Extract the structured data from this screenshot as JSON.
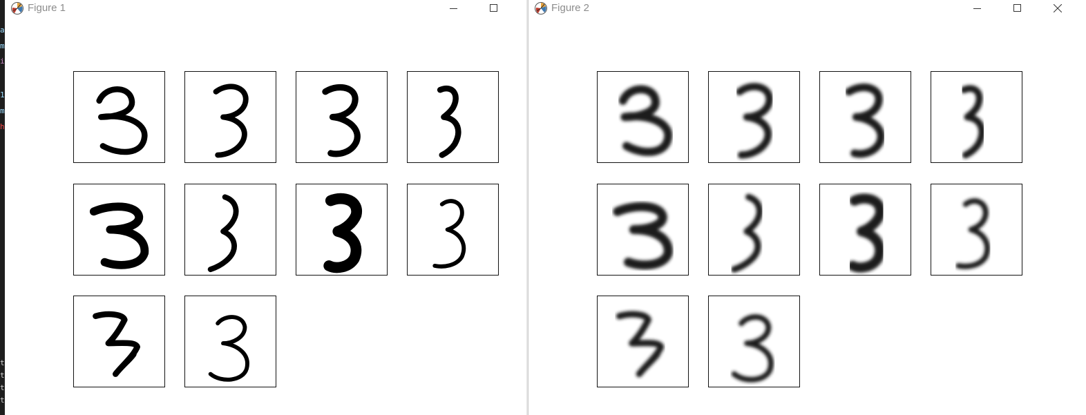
{
  "windows": [
    {
      "title": "Figure 1",
      "controls": [
        "minimize-icon",
        "maximize-icon"
      ],
      "grid": {
        "cols": 4,
        "count": 10
      },
      "style": "crisp"
    },
    {
      "title": "Figure 2",
      "controls": [
        "minimize-icon",
        "maximize-icon",
        "close-icon"
      ],
      "grid": {
        "cols": 4,
        "count": 10
      },
      "style": "blurred"
    }
  ],
  "digits_shown": "3",
  "background_editor_glyphs": [
    {
      "ch": "a",
      "color": "#9cdcfe"
    },
    {
      "ch": "m",
      "color": "#9cdcfe"
    },
    {
      "ch": "i",
      "color": "#c586c0"
    },
    {
      "ch": "1",
      "color": "#9cdcfe"
    },
    {
      "ch": "m",
      "color": "#9cdcfe"
    },
    {
      "ch": "h",
      "color": "#f44747"
    },
    {
      "ch": "t",
      "color": "#d4d4d4"
    },
    {
      "ch": "t",
      "color": "#d4d4d4"
    },
    {
      "ch": "t",
      "color": "#d4d4d4"
    },
    {
      "ch": "t",
      "color": "#d4d4d4"
    }
  ]
}
